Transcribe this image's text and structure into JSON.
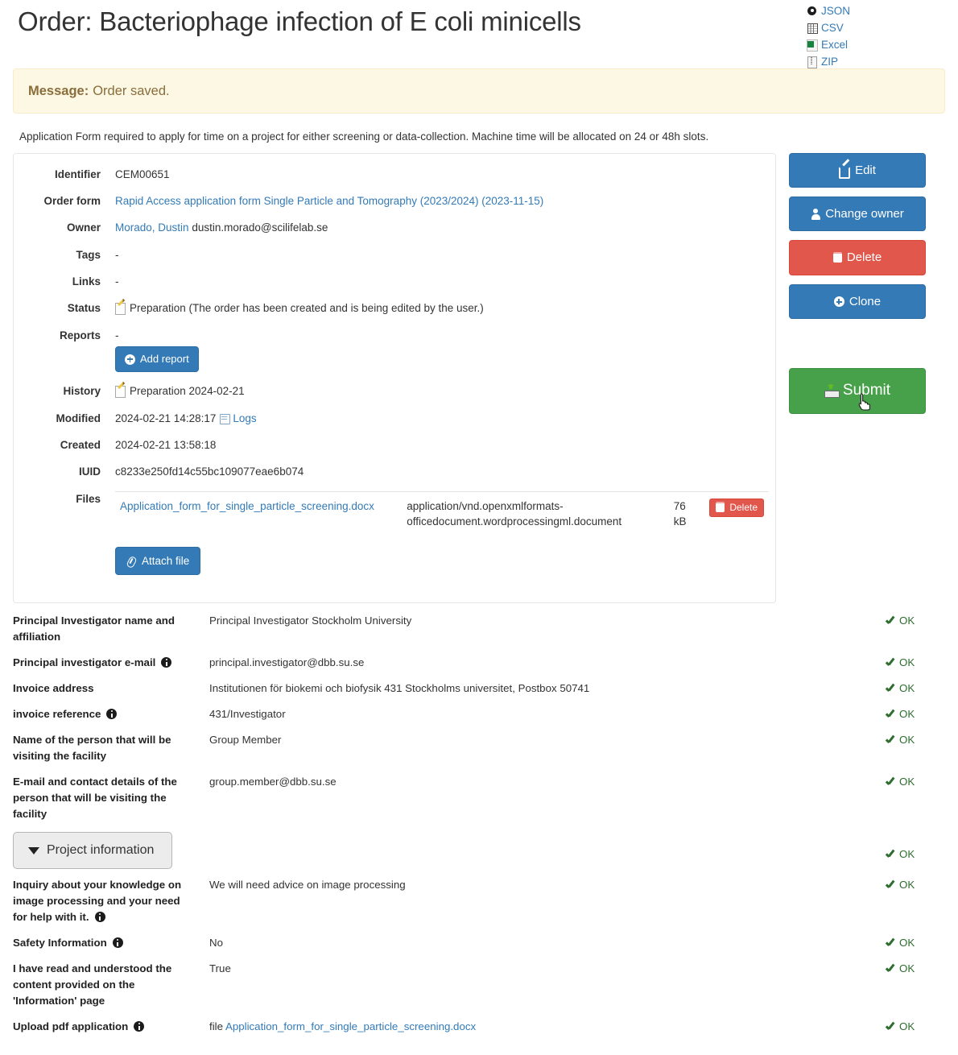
{
  "header": {
    "title": "Order: Bacteriophage infection of E coli minicells",
    "exports": [
      {
        "label": "JSON",
        "icon": "json-icon"
      },
      {
        "label": "CSV",
        "icon": "csv-icon"
      },
      {
        "label": "Excel",
        "icon": "excel-icon"
      },
      {
        "label": "ZIP",
        "icon": "zip-icon"
      }
    ]
  },
  "message": {
    "label": "Message:",
    "text": "Order saved."
  },
  "intro": "Application Form required to apply for time on a project for either screening or data-collection. Machine time will be allocated on 24 or 48h slots.",
  "details": {
    "identifier_label": "Identifier",
    "identifier_value": "CEM00651",
    "order_form_label": "Order form",
    "order_form_value": "Rapid Access application form Single Particle and Tomography (2023/2024) (2023-11-15)",
    "owner_label": "Owner",
    "owner_name": "Morado, Dustin",
    "owner_email": "dustin.morado@scilifelab.se",
    "tags_label": "Tags",
    "tags_value": "-",
    "links_label": "Links",
    "links_value": "-",
    "status_label": "Status",
    "status_value": "Preparation (The order has been created and is being edited by the user.)",
    "reports_label": "Reports",
    "reports_value": "-",
    "add_report_label": "Add report",
    "history_label": "History",
    "history_value": "Preparation 2024-02-21",
    "modified_label": "Modified",
    "modified_value": "2024-02-21 14:28:17",
    "logs_label": "Logs",
    "created_label": "Created",
    "created_value": "2024-02-21 13:58:18",
    "iuid_label": "IUID",
    "iuid_value": "c8233e250fd14c55bc109077eae6b074",
    "files_label": "Files",
    "attach_file_label": "Attach file",
    "files": [
      {
        "name": "Application_form_for_single_particle_screening.docx",
        "type": "application/vnd.openxmlformats-officedocument.wordprocessingml.document",
        "size": "76 kB",
        "delete_label": "Delete"
      }
    ]
  },
  "actions": {
    "edit_label": "Edit",
    "change_owner_label": "Change owner",
    "delete_label": "Delete",
    "clone_label": "Clone",
    "submit_label": "Submit"
  },
  "fields": [
    {
      "name": "Principal Investigator name and affiliation",
      "info": false,
      "value": "Principal Investigator Stockholm University",
      "status": "OK"
    },
    {
      "name": "Principal investigator e-mail",
      "info": true,
      "value": "principal.investigator@dbb.su.se",
      "status": "OK"
    },
    {
      "name": "Invoice address",
      "info": false,
      "value": "Institutionen för biokemi och biofysik 431 Stockholms universitet, Postbox 50741",
      "status": "OK"
    },
    {
      "name": "invoice reference",
      "info": true,
      "value": "431/Investigator",
      "status": "OK"
    },
    {
      "name": "Name of the person that will be visiting the facility",
      "info": false,
      "value": "Group Member",
      "status": "OK"
    },
    {
      "name": "E-mail and contact details of the person that will be visiting the facility",
      "info": false,
      "value": "group.member@dbb.su.se",
      "status": "OK"
    }
  ],
  "group": {
    "label": "Project information",
    "status": "OK"
  },
  "fields2": [
    {
      "name": "Inquiry about your knowledge on image processing and your need for help with it.",
      "info": true,
      "value": "We will need advice on image processing",
      "status": "OK"
    },
    {
      "name": "Safety Information",
      "info": true,
      "value": "No",
      "status": "OK"
    },
    {
      "name": "I have read and understood the content provided on the 'Information' page",
      "info": false,
      "value": "True",
      "status": "OK"
    }
  ],
  "upload_field": {
    "name": "Upload pdf application",
    "info": true,
    "value_prefix": "file",
    "value_link": "Application_form_for_single_particle_screening.docx",
    "status": "OK"
  },
  "colors": {
    "primary": "#337ab7",
    "danger": "#e2574c",
    "success": "#46a14a",
    "link": "#337ab7",
    "ok": "#2f6e31",
    "banner_bg": "#fcf8e3",
    "banner_text": "#8a6d3b"
  }
}
